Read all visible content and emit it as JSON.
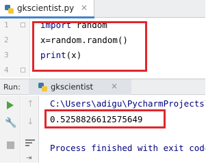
{
  "editor": {
    "tab_label": "gkscientist.py",
    "tab_close": "×",
    "line_numbers": [
      "1",
      "2",
      "3",
      "4"
    ],
    "code": {
      "line1_kw": "import",
      "line1_rest": " random",
      "line2": "x=random.random()",
      "line3_kw": "print",
      "line3_rest": "(x)"
    }
  },
  "run": {
    "title": "Run:",
    "tab_label": "gkscientist",
    "tab_close": "×",
    "console": {
      "path": "C:\\Users\\adigu\\PycharmProjects\\",
      "output": "0.5258826612575649",
      "exit": "Process finished with exit code 0"
    }
  },
  "colors": {
    "highlight_box": "#e0262c",
    "keyword": "#000080",
    "tab_underline": "#4083c9",
    "run_green": "#4aa53b"
  },
  "icons": [
    "python-file-icon",
    "run-icon",
    "wrench-icon",
    "stop-icon",
    "arrow-up-icon",
    "arrow-down-icon",
    "soft-wrap-icon"
  ]
}
